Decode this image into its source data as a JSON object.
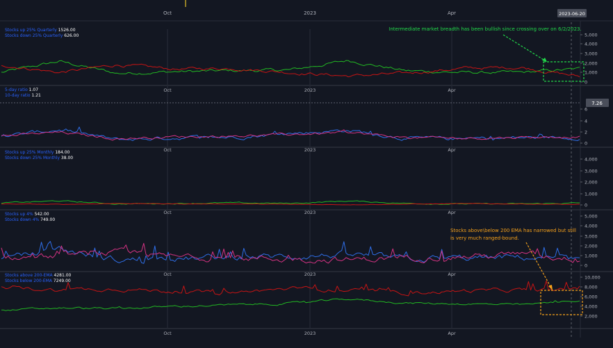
{
  "date_badge": "2023-06-20",
  "x_ticks": [
    "Oct",
    "2023",
    "Apr"
  ],
  "colors": {
    "background": "#131722",
    "grid": "#2a2e39",
    "axis_text": "#b2b5be",
    "legend_label": "#2962ff",
    "green": "#22b822",
    "red": "#c81414",
    "blue": "#2f6ee8",
    "pink": "#d63384",
    "annotation_green": "#22d84a",
    "annotation_orange": "#f7a21b"
  },
  "panes": [
    {
      "id": "quarterly",
      "legend": [
        {
          "label": "Stocks up 25% Quarterly",
          "value": "1526.00"
        },
        {
          "label": "Stocks down 25% Quarterly",
          "value": "626.00"
        }
      ],
      "y_ticks": [
        "5,000",
        "4,000",
        "3,000",
        "2,000",
        "1,000",
        "0"
      ],
      "annotation": "Intermediate market breadth has been bullish since crossing over on 6/2/2023."
    },
    {
      "id": "ratio",
      "legend": [
        {
          "label": "5-day ratio",
          "value": "1.07"
        },
        {
          "label": "10-day ratio",
          "value": "1.21"
        }
      ],
      "y_ticks": [
        "6",
        "4",
        "2",
        "0"
      ],
      "marker": "7.26"
    },
    {
      "id": "monthly",
      "legend": [
        {
          "label": "Stocks up 25% Monthly",
          "value": "184.00"
        },
        {
          "label": "Stocks down 25% Monthly",
          "value": "38.00"
        }
      ],
      "y_ticks": [
        "4,000",
        "3,000",
        "2,000",
        "1,000",
        "0"
      ]
    },
    {
      "id": "four_pct",
      "legend": [
        {
          "label": "Stocks up 4%",
          "value": "542.00"
        },
        {
          "label": "Stocks down 4%",
          "value": "749.00"
        }
      ],
      "y_ticks": [
        "5,000",
        "4,000",
        "3,000",
        "2,000",
        "1,000",
        "0"
      ],
      "annotation": "Stocks above\\below 200 EMA has narrowed but still is very much ranged-bound."
    },
    {
      "id": "ema200",
      "legend": [
        {
          "label": "Stocks above 200-EMA",
          "value": "4281.00"
        },
        {
          "label": "Stocks below 200-EMA",
          "value": "7249.00"
        }
      ],
      "y_ticks": [
        "10,000",
        "8,000",
        "6,000",
        "4,000",
        "2,000"
      ]
    }
  ],
  "chart_data": [
    {
      "type": "line",
      "x": [
        "2022-08",
        "2022-09",
        "2022-10",
        "2022-11",
        "2022-12",
        "2023-01",
        "2023-02",
        "2023-03",
        "2023-04",
        "2023-05",
        "2023-06"
      ],
      "series": [
        {
          "name": "Stocks up 25% Quarterly",
          "values": [
            1100,
            2400,
            1000,
            1200,
            1300,
            1400,
            2500,
            1300,
            1100,
            1100,
            1526
          ]
        },
        {
          "name": "Stocks down 25% Quarterly",
          "values": [
            2000,
            1100,
            2000,
            1500,
            1600,
            1100,
            700,
            1000,
            1600,
            1700,
            626
          ]
        }
      ],
      "ylim": [
        0,
        5500
      ]
    },
    {
      "type": "line",
      "x": [
        "2022-08",
        "2022-09",
        "2022-10",
        "2022-11",
        "2022-12",
        "2023-01",
        "2023-02",
        "2023-03",
        "2023-04",
        "2023-05",
        "2023-06"
      ],
      "series": [
        {
          "name": "5-day ratio",
          "values": [
            1.2,
            2.5,
            0.6,
            1.0,
            1.1,
            1.8,
            2.4,
            0.9,
            0.8,
            1.0,
            1.07
          ]
        },
        {
          "name": "10-day ratio",
          "values": [
            1.3,
            2.0,
            0.8,
            1.2,
            1.3,
            1.6,
            2.0,
            1.0,
            0.9,
            1.1,
            1.21
          ]
        }
      ],
      "ylim": [
        0,
        7.5
      ]
    },
    {
      "type": "line",
      "x": [
        "2022-08",
        "2022-09",
        "2022-10",
        "2022-11",
        "2022-12",
        "2023-01",
        "2023-02",
        "2023-03",
        "2023-04",
        "2023-05",
        "2023-06"
      ],
      "series": [
        {
          "name": "Stocks up 25% Monthly",
          "values": [
            200,
            400,
            100,
            150,
            200,
            150,
            400,
            150,
            100,
            100,
            184
          ]
        },
        {
          "name": "Stocks down 25% Monthly",
          "values": [
            100,
            50,
            150,
            100,
            100,
            50,
            30,
            80,
            120,
            100,
            38
          ]
        }
      ],
      "ylim": [
        0,
        4600
      ]
    },
    {
      "type": "line",
      "x": [
        "2022-08",
        "2022-09",
        "2022-10",
        "2022-11",
        "2022-12",
        "2023-01",
        "2023-02",
        "2023-03",
        "2023-04",
        "2023-05",
        "2023-06"
      ],
      "series": [
        {
          "name": "Stocks up 4%",
          "values": [
            600,
            1800,
            600,
            700,
            900,
            1000,
            1200,
            700,
            800,
            900,
            542
          ]
        },
        {
          "name": "Stocks down 4%",
          "values": [
            800,
            1000,
            1400,
            900,
            800,
            700,
            600,
            900,
            1000,
            1200,
            749
          ]
        }
      ],
      "ylim": [
        0,
        5500
      ]
    },
    {
      "type": "line",
      "x": [
        "2022-08",
        "2022-09",
        "2022-10",
        "2022-11",
        "2022-12",
        "2023-01",
        "2023-02",
        "2023-03",
        "2023-04",
        "2023-05",
        "2023-06"
      ],
      "series": [
        {
          "name": "Stocks above 200-EMA",
          "values": [
            1500,
            2200,
            2000,
            2600,
            3000,
            3400,
            4600,
            3500,
            3300,
            3000,
            4281
          ]
        },
        {
          "name": "Stocks below 200-EMA",
          "values": [
            7800,
            7000,
            7400,
            6600,
            6300,
            7400,
            7000,
            6200,
            6800,
            7000,
            7249
          ]
        }
      ],
      "ylim": [
        0,
        10500
      ]
    }
  ]
}
